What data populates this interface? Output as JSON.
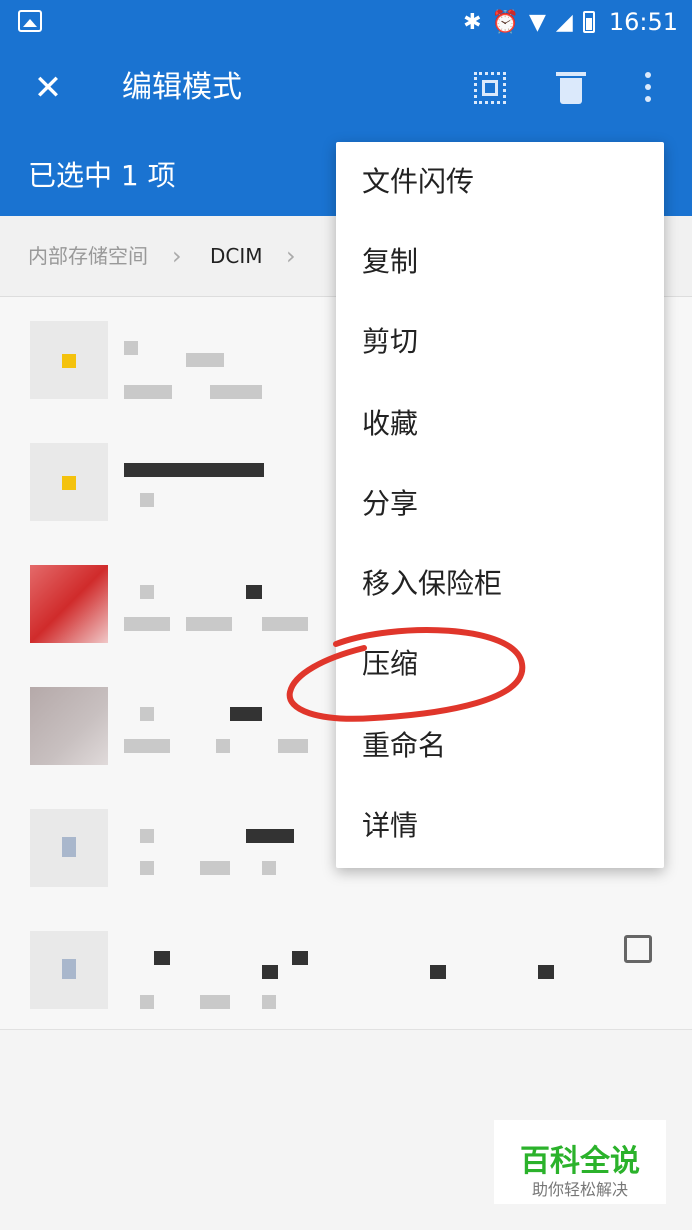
{
  "status_bar": {
    "time": "16:51",
    "icons": [
      "image-icon",
      "bluetooth-icon",
      "alarm-icon",
      "wifi-icon",
      "signal-icon",
      "battery-icon"
    ]
  },
  "app_bar": {
    "title": "编辑模式",
    "selected_count": "已选中 1 项",
    "actions": [
      "close-icon",
      "select-all-icon",
      "delete-icon",
      "more-icon"
    ],
    "accent_color": "#1a73d1"
  },
  "breadcrumb": {
    "items": [
      "内部存储空间",
      "DCIM"
    ]
  },
  "context_menu": {
    "items": [
      {
        "label": "文件闪传"
      },
      {
        "label": "复制"
      },
      {
        "label": "剪切"
      },
      {
        "label": "收藏"
      },
      {
        "label": "分享"
      },
      {
        "label": "移入保险柜"
      },
      {
        "label": "压缩"
      },
      {
        "label": "重命名"
      },
      {
        "label": "详情"
      }
    ]
  },
  "watermark": {
    "title": "百科全说",
    "subtitle": "助你轻松解决",
    "color": "#2bb22b"
  }
}
